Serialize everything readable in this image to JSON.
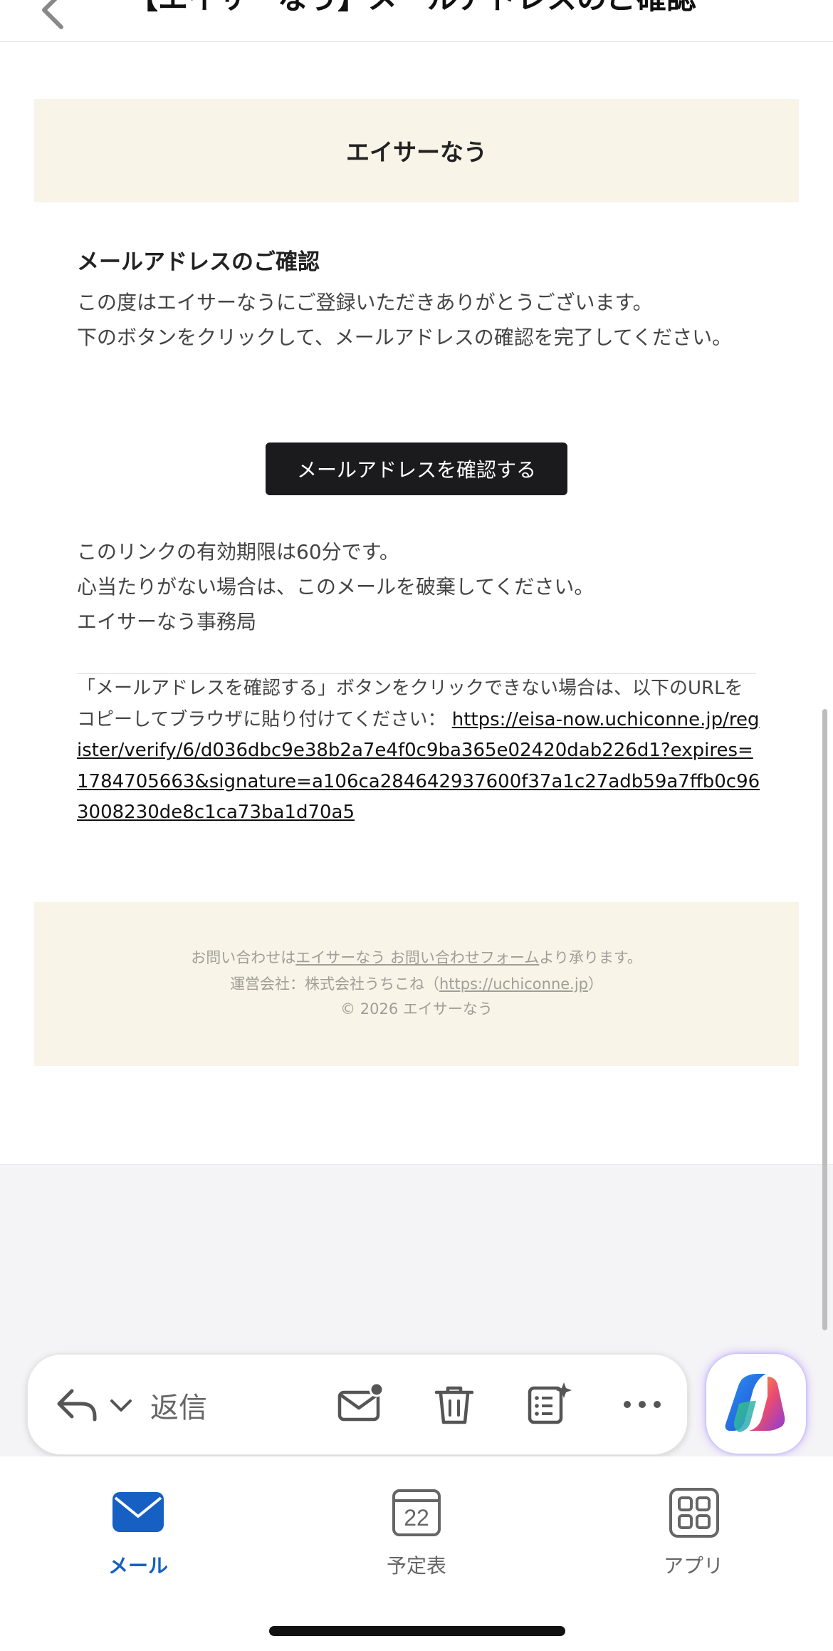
{
  "nav": {
    "subject": "【エイサーなう】メールアドレスのご確認"
  },
  "email": {
    "brand": "エイサーなう",
    "heading": "メールアドレスのご確認",
    "intro_line1": "この度はエイサーなうにご登録いただきありがとうございます。",
    "intro_line2": "下のボタンをクリックして、メールアドレスの確認を完了してください。",
    "confirm_button": "メールアドレスを確認する",
    "expiry": "このリンクの有効期限は60分です。",
    "ignore": "心当たりがない場合は、このメールを破棄してください。",
    "signature": "エイサーなう事務局",
    "fallback_text": "「メールアドレスを確認する」ボタンをクリックできない場合は、以下のURLをコピーしてブラウザに貼り付けてください：",
    "fallback_url": "https://eisa-now.uchiconne.jp/register/verify/6/d036dbc9e38b2a7e4f0c9ba365e02420dab226d1?expires=1784705663&signature=a106ca284642937600f37a1c27adb59a7ffb0c963008230de8c1ca73ba1d70a5"
  },
  "footer": {
    "contact_prefix": "お問い合わせは",
    "contact_link": "エイサーなう お問い合わせフォーム",
    "contact_suffix": "より承ります。",
    "operator_prefix": "運営会社：株式会社うちこね（",
    "operator_link": "https://uchiconne.jp",
    "operator_suffix": "）",
    "copyright": "© 2026 エイサーなう"
  },
  "toolbar": {
    "reply_label": "返信",
    "icons": [
      "reply-icon",
      "chevron-down-icon",
      "mark-unread-icon",
      "trash-icon",
      "ai-summary-icon",
      "more-icon",
      "copilot-icon"
    ]
  },
  "tabs": [
    {
      "label": "メール",
      "active": true
    },
    {
      "label": "予定表",
      "date": "22"
    },
    {
      "label": "アプリ"
    }
  ],
  "colors": {
    "accent": "#1560c2",
    "banner_bg": "#f8f4e8",
    "button_bg": "#1b1b1d"
  }
}
